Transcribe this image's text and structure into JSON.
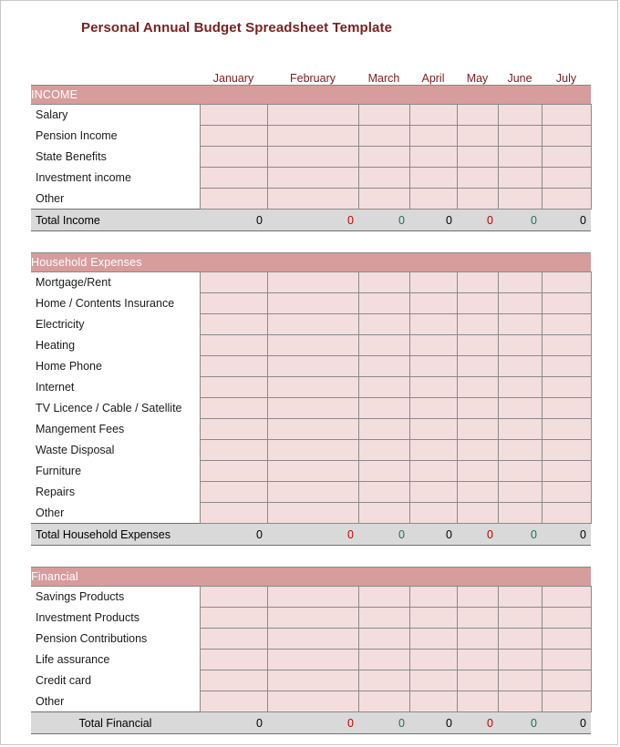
{
  "document": {
    "title": "Personal Annual Budget Spreadsheet Template"
  },
  "colors": {
    "title_text": "#7a2020",
    "section_header_bg": "#d79c9c",
    "section_header_text": "#ffffff",
    "cell_bg": "#f3dedd",
    "total_row_bg": "#d9d9d9",
    "grid_line": "#8a8a8a",
    "zero_black": "#000000",
    "zero_red": "#c00000",
    "zero_green": "#1f6f5c"
  },
  "columns": {
    "label_header": "",
    "months": [
      "January",
      "February",
      "March",
      "April",
      "May",
      "June",
      "July"
    ]
  },
  "sections": [
    {
      "id": "income",
      "header": "INCOME",
      "rows": [
        {
          "label": "Salary",
          "values": [
            "",
            "",
            "",
            "",
            "",
            "",
            ""
          ]
        },
        {
          "label": "Pension Income",
          "values": [
            "",
            "",
            "",
            "",
            "",
            "",
            ""
          ]
        },
        {
          "label": "State Benefits",
          "values": [
            "",
            "",
            "",
            "",
            "",
            "",
            ""
          ]
        },
        {
          "label": "Investment income",
          "values": [
            "",
            "",
            "",
            "",
            "",
            "",
            ""
          ]
        },
        {
          "label": "Other",
          "values": [
            "",
            "",
            "",
            "",
            "",
            "",
            ""
          ]
        }
      ],
      "total": {
        "label": "Total Income",
        "label_align": "left",
        "values": [
          "0",
          "0",
          "0",
          "0",
          "0",
          "0",
          "0"
        ],
        "value_colors": [
          "#000000",
          "#c00000",
          "#1f6f5c",
          "#000000",
          "#c00000",
          "#1f6f5c",
          "#000000"
        ]
      }
    },
    {
      "id": "household-expenses",
      "header": "Household Expenses",
      "rows": [
        {
          "label": "Mortgage/Rent",
          "values": [
            "",
            "",
            "",
            "",
            "",
            "",
            ""
          ]
        },
        {
          "label": "Home / Contents Insurance",
          "values": [
            "",
            "",
            "",
            "",
            "",
            "",
            ""
          ]
        },
        {
          "label": "Electricity",
          "values": [
            "",
            "",
            "",
            "",
            "",
            "",
            ""
          ]
        },
        {
          "label": "Heating",
          "values": [
            "",
            "",
            "",
            "",
            "",
            "",
            ""
          ]
        },
        {
          "label": "Home Phone",
          "values": [
            "",
            "",
            "",
            "",
            "",
            "",
            ""
          ]
        },
        {
          "label": "Internet",
          "values": [
            "",
            "",
            "",
            "",
            "",
            "",
            ""
          ]
        },
        {
          "label": "TV Licence / Cable / Satellite",
          "values": [
            "",
            "",
            "",
            "",
            "",
            "",
            ""
          ]
        },
        {
          "label": "Mangement Fees",
          "values": [
            "",
            "",
            "",
            "",
            "",
            "",
            ""
          ]
        },
        {
          "label": "Waste Disposal",
          "values": [
            "",
            "",
            "",
            "",
            "",
            "",
            ""
          ]
        },
        {
          "label": "Furniture",
          "values": [
            "",
            "",
            "",
            "",
            "",
            "",
            ""
          ]
        },
        {
          "label": "Repairs",
          "values": [
            "",
            "",
            "",
            "",
            "",
            "",
            ""
          ]
        },
        {
          "label": "Other",
          "values": [
            "",
            "",
            "",
            "",
            "",
            "",
            ""
          ]
        }
      ],
      "total": {
        "label": "Total Household Expenses",
        "label_align": "left",
        "values": [
          "0",
          "0",
          "0",
          "0",
          "0",
          "0",
          "0"
        ],
        "value_colors": [
          "#000000",
          "#c00000",
          "#1f6f5c",
          "#000000",
          "#c00000",
          "#1f6f5c",
          "#000000"
        ]
      }
    },
    {
      "id": "financial",
      "header": "Financial",
      "rows": [
        {
          "label": "Savings Products",
          "values": [
            "",
            "",
            "",
            "",
            "",
            "",
            ""
          ]
        },
        {
          "label": "Investment Products",
          "values": [
            "",
            "",
            "",
            "",
            "",
            "",
            ""
          ]
        },
        {
          "label": "Pension Contributions",
          "values": [
            "",
            "",
            "",
            "",
            "",
            "",
            ""
          ]
        },
        {
          "label": "Life assurance",
          "values": [
            "",
            "",
            "",
            "",
            "",
            "",
            ""
          ]
        },
        {
          "label": "Credit card",
          "values": [
            "",
            "",
            "",
            "",
            "",
            "",
            ""
          ]
        },
        {
          "label": "Other",
          "values": [
            "",
            "",
            "",
            "",
            "",
            "",
            ""
          ]
        }
      ],
      "total": {
        "label": "Total Financial",
        "label_align": "center",
        "values": [
          "0",
          "0",
          "0",
          "0",
          "0",
          "0",
          "0"
        ],
        "value_colors": [
          "#000000",
          "#c00000",
          "#1f6f5c",
          "#000000",
          "#c00000",
          "#1f6f5c",
          "#000000"
        ]
      }
    }
  ]
}
